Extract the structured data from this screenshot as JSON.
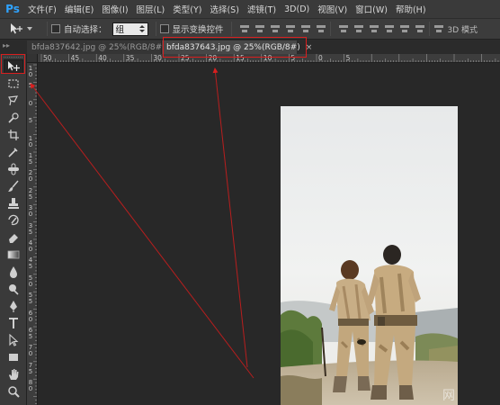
{
  "app": {
    "logo": "Ps"
  },
  "menu": [
    "文件(F)",
    "编辑(E)",
    "图像(I)",
    "图层(L)",
    "类型(Y)",
    "选择(S)",
    "滤镜(T)",
    "3D(D)",
    "视图(V)",
    "窗口(W)",
    "帮助(H)"
  ],
  "options": {
    "auto_select_label": "自动选择：",
    "auto_select_value": "组",
    "show_transform_label": "显示变换控件",
    "mode_3d_label": "3D 模式"
  },
  "tabs": [
    {
      "label": "bfda837642.jpg @ 25%(RGB/8#)",
      "close": "×",
      "active": false
    },
    {
      "label": "bfda837643.jpg @ 25%(RGB/8#)",
      "close": "×",
      "active": true
    }
  ],
  "ruler_top_labels": [
    "50",
    "45",
    "40",
    "35",
    "30",
    "25",
    "20",
    "15",
    "10",
    "5",
    "0",
    "5"
  ],
  "ruler_left_labels": [
    "1\n0",
    "5",
    "0",
    "5",
    "1\n0",
    "1\n5",
    "2\n0",
    "2\n5",
    "3\n0",
    "3\n5",
    "4\n0",
    "4\n5",
    "5\n0",
    "5\n5",
    "6\n0",
    "6\n5",
    "7\n0",
    "7\n5",
    "8\n0"
  ],
  "tools": [
    "move-icon",
    "marquee-icon",
    "lasso-icon",
    "quick-select-icon",
    "crop-icon",
    "eyedropper-icon",
    "healing-icon",
    "brush-icon",
    "stamp-icon",
    "history-brush-icon",
    "eraser-icon",
    "gradient-icon",
    "blur-icon",
    "dodge-icon",
    "pen-icon",
    "type-icon",
    "path-select-icon",
    "rectangle-icon",
    "hand-icon",
    "zoom-icon"
  ],
  "colors": {
    "annotation": "#d91f1f",
    "accent": "#2fa3ff"
  }
}
